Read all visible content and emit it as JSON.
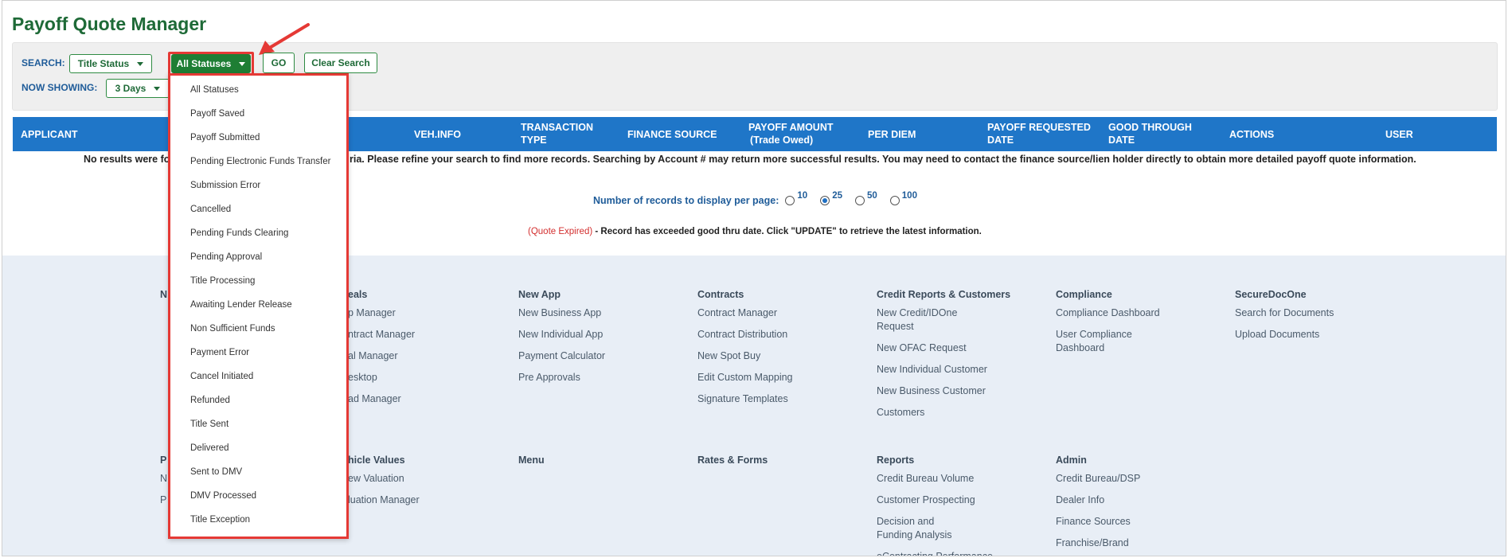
{
  "title": "Payoff Quote Manager",
  "search": {
    "label": "SEARCH:",
    "field_select": "Title Status",
    "status_select": "All Statuses",
    "go_label": "GO",
    "clear_label": "Clear Search",
    "showing_label": "NOW SHOWING:",
    "showing_value": "3 Days"
  },
  "table": {
    "headers": [
      {
        "line1": "APPLICANT",
        "line2": ""
      },
      {
        "line1": "VEH.INFO",
        "line2": ""
      },
      {
        "line1": "TRANSACTION",
        "line2": "TYPE"
      },
      {
        "line1": "FINANCE SOURCE",
        "line2": ""
      },
      {
        "line1": "PAYOFF AMOUNT",
        "line2": "(Trade Owed)"
      },
      {
        "line1": "PER DIEM",
        "line2": ""
      },
      {
        "line1": "PAYOFF REQUESTED",
        "line2": "DATE"
      },
      {
        "line1": "GOOD THROUGH",
        "line2": "DATE"
      },
      {
        "line1": "ACTIONS",
        "line2": ""
      },
      {
        "line1": "USER",
        "line2": ""
      }
    ],
    "no_results_left": "No results were fo",
    "no_results_right": "ria. Please refine your search to find more records. Searching by Account # may return more successful results. You may need to contact the finance source/lien holder directly to obtain more detailed payoff quote information."
  },
  "pagination": {
    "label": "Number of records to display per page:",
    "options": [
      "10",
      "25",
      "50",
      "100"
    ],
    "selected": "25"
  },
  "expired_note": {
    "tag": "(Quote Expired)",
    "text": " - Record has exceeded good thru date. Click \"UPDATE\" to retrieve the latest information."
  },
  "dropdown": {
    "items": [
      "All Statuses",
      "Payoff Saved",
      "Payoff Submitted",
      "Pending Electronic Funds Transfer",
      "Submission Error",
      "Cancelled",
      "Pending Funds Clearing",
      "Pending Approval",
      "Title Processing",
      "Awaiting Lender Release",
      "Non Sufficient Funds",
      "Payment Error",
      "Cancel Initiated",
      "Refunded",
      "Title Sent",
      "Delivered",
      "Sent to DMV",
      "DMV Processed",
      "Title Exception"
    ]
  },
  "footer": {
    "col0": {
      "head": "N",
      "head2": "P",
      "links2": [
        "N",
        "P"
      ]
    },
    "col1": {
      "head": "eals",
      "links": [
        "p Manager",
        "ntract Manager",
        "al Manager",
        "esktop",
        "ad Manager"
      ],
      "head2": "hicle Values",
      "links2": [
        "ew Valuation",
        "luation Manager"
      ]
    },
    "col2": {
      "head": "New App",
      "links": [
        "New Business App",
        "New Individual App",
        "Payment Calculator",
        "Pre Approvals"
      ],
      "head2": "Menu",
      "links2": []
    },
    "col3": {
      "head": "Contracts",
      "links": [
        "Contract Manager",
        "Contract Distribution",
        "New Spot Buy",
        "Edit Custom Mapping",
        "Signature Templates"
      ],
      "head2": "Rates & Forms",
      "links2": []
    },
    "col4": {
      "head": "Credit Reports & Customers",
      "links": [
        "New Credit/IDOne Request",
        "New OFAC Request",
        "New Individual Customer",
        "New Business Customer",
        "Customers"
      ],
      "head2": "Reports",
      "links2": [
        "Credit Bureau Volume",
        "Customer Prospecting",
        "Decision and Funding Analysis",
        "eContracting Performance"
      ]
    },
    "col5": {
      "head": "Compliance",
      "links": [
        "Compliance Dashboard",
        "User Compliance Dashboard"
      ],
      "head2": "Admin",
      "links2": [
        "Credit Bureau/DSP",
        "Dealer Info",
        "Finance Sources",
        "Franchise/Brand"
      ]
    },
    "col6": {
      "head": "SecureDocOne",
      "links": [
        "Search for Documents",
        "Upload Documents"
      ]
    }
  },
  "colors": {
    "brand_green": "#1e6a37",
    "header_blue": "#1f76c8",
    "highlight_red": "#e53935",
    "footer_bg": "#e8eef6"
  }
}
